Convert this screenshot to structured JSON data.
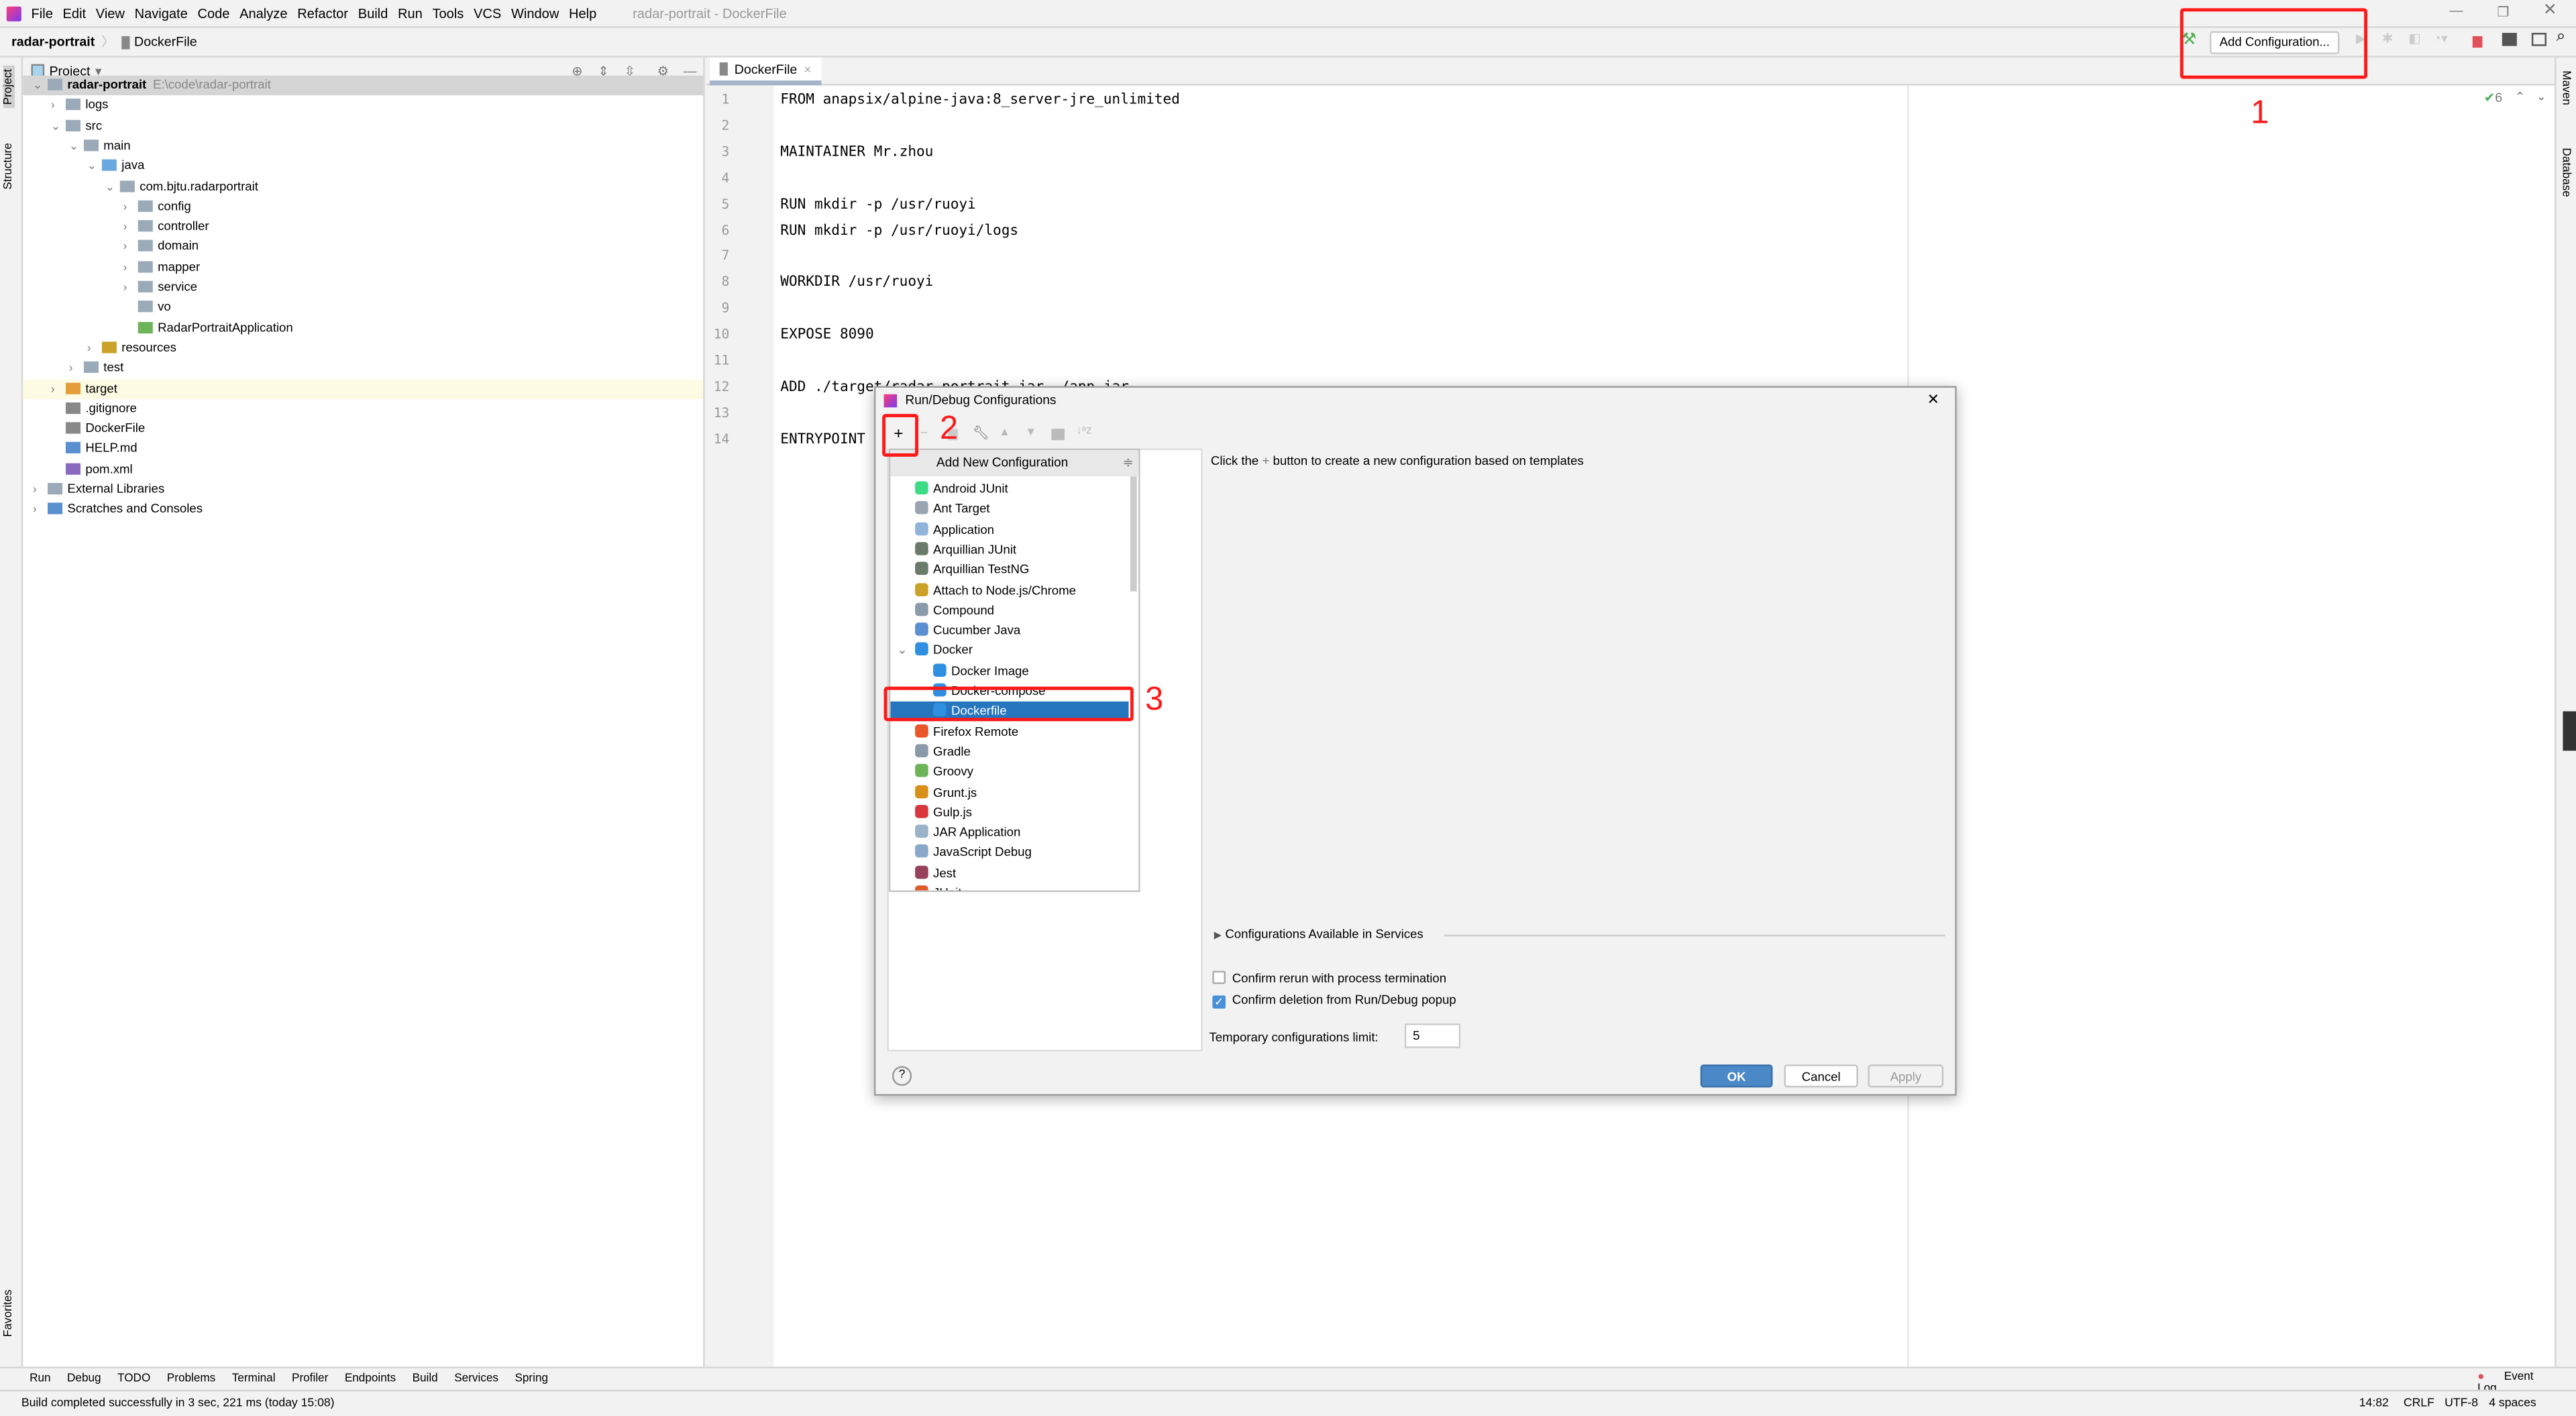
{
  "menu": {
    "items": [
      "File",
      "Edit",
      "View",
      "Navigate",
      "Code",
      "Analyze",
      "Refactor",
      "Build",
      "Run",
      "Tools",
      "VCS",
      "Window",
      "Help"
    ],
    "window_title": "radar-portrait - DockerFile"
  },
  "breadcrumb": {
    "project": "radar-portrait",
    "file": "DockerFile"
  },
  "toolbar": {
    "add_configuration": "Add Configuration..."
  },
  "left_stripe": {
    "project": "Project",
    "structure": "Structure",
    "favorites": "Favorites"
  },
  "right_stripe": {
    "maven": "Maven",
    "database": "Database"
  },
  "project_panel": {
    "title": "Project",
    "tree": [
      {
        "label": "radar-portrait",
        "path": "E:\\code\\radar-portrait",
        "level": 0,
        "expanded": true,
        "bold": true,
        "icon": "module-folder"
      },
      {
        "label": "logs",
        "level": 1,
        "expanded": false,
        "icon": "folder"
      },
      {
        "label": "src",
        "level": 1,
        "expanded": true,
        "icon": "folder"
      },
      {
        "label": "main",
        "level": 2,
        "expanded": true,
        "icon": "folder"
      },
      {
        "label": "java",
        "level": 3,
        "expanded": true,
        "icon": "source-folder"
      },
      {
        "label": "com.bjtu.radarportrait",
        "level": 4,
        "expanded": true,
        "icon": "package"
      },
      {
        "label": "config",
        "level": 5,
        "expanded": false,
        "icon": "package"
      },
      {
        "label": "controller",
        "level": 5,
        "expanded": false,
        "icon": "package"
      },
      {
        "label": "domain",
        "level": 5,
        "expanded": false,
        "icon": "package"
      },
      {
        "label": "mapper",
        "level": 5,
        "expanded": false,
        "icon": "package"
      },
      {
        "label": "service",
        "level": 5,
        "expanded": false,
        "icon": "package"
      },
      {
        "label": "vo",
        "level": 5,
        "icon": "package"
      },
      {
        "label": "RadarPortraitApplication",
        "level": 5,
        "icon": "spring-class"
      },
      {
        "label": "resources",
        "level": 3,
        "expanded": false,
        "icon": "resources-folder"
      },
      {
        "label": "test",
        "level": 2,
        "expanded": false,
        "icon": "folder"
      },
      {
        "label": "target",
        "level": 1,
        "expanded": false,
        "icon": "excluded-folder",
        "highlight": true
      },
      {
        "label": ".gitignore",
        "level": 1,
        "icon": "file"
      },
      {
        "label": "DockerFile",
        "level": 1,
        "icon": "file"
      },
      {
        "label": "HELP.md",
        "level": 1,
        "icon": "markdown"
      },
      {
        "label": "pom.xml",
        "level": 1,
        "icon": "maven"
      },
      {
        "label": "External Libraries",
        "level": 0,
        "expanded": false,
        "icon": "libraries"
      },
      {
        "label": "Scratches and Consoles",
        "level": 0,
        "expanded": false,
        "icon": "scratches"
      }
    ]
  },
  "editor": {
    "tab": "DockerFile",
    "inspection_count": "6",
    "lines": [
      "FROM anapsix/alpine-java:8_server-jre_unlimited",
      "",
      "MAINTAINER Mr.zhou",
      "",
      "RUN mkdir -p /usr/ruoyi",
      "RUN mkdir -p /usr/ruoyi/logs",
      "",
      "WORKDIR /usr/ruoyi",
      "",
      "EXPOSE 8090",
      "",
      "ADD ./target/radar-portrait.jar ./app.jar",
      "",
      "ENTRYPOINT"
    ]
  },
  "dialog": {
    "title": "Run/Debug Configurations",
    "list_header": "Add New Configuration",
    "items": [
      {
        "label": "Android JUnit",
        "color": "#3ddc84"
      },
      {
        "label": "Ant Target",
        "color": "#9aa5b1"
      },
      {
        "label": "Application",
        "color": "#8fb3d9"
      },
      {
        "label": "Arquillian JUnit",
        "color": "#6b7b6b"
      },
      {
        "label": "Arquillian TestNG",
        "color": "#6b7b6b"
      },
      {
        "label": "Attach to Node.js/Chrome",
        "color": "#c9a227"
      },
      {
        "label": "Compound",
        "color": "#8a9aa8"
      },
      {
        "label": "Cucumber Java",
        "color": "#5a8fd0"
      },
      {
        "label": "Docker",
        "color": "#2f8fe0",
        "group": true
      },
      {
        "label": "Docker Image",
        "color": "#2f8fe0",
        "child": true
      },
      {
        "label": "Docker-compose",
        "color": "#2f8fe0",
        "child": true
      },
      {
        "label": "Dockerfile",
        "color": "#2f8fe0",
        "child": true,
        "selected": true
      },
      {
        "label": "Firefox Remote",
        "color": "#e8562a"
      },
      {
        "label": "Gradle",
        "color": "#8a9aa8"
      },
      {
        "label": "Groovy",
        "color": "#6cb35a"
      },
      {
        "label": "Grunt.js",
        "color": "#d9901a"
      },
      {
        "label": "Gulp.js",
        "color": "#d9363e"
      },
      {
        "label": "JAR Application",
        "color": "#9ab3c9"
      },
      {
        "label": "JavaScript Debug",
        "color": "#8aa8c9"
      },
      {
        "label": "Jest",
        "color": "#99425b"
      },
      {
        "label": "JUnit",
        "color": "#e05a2a"
      }
    ],
    "hint_prefix": "Click the",
    "hint_suffix": "button to create a new configuration based on templates",
    "services_label": "Configurations Available in Services",
    "confirm_rerun": {
      "label": "Confirm rerun with process termination",
      "checked": false
    },
    "confirm_deletion": {
      "label": "Confirm deletion from Run/Debug popup",
      "checked": true
    },
    "temp_limit_label": "Temporary configurations limit:",
    "temp_limit_value": "5",
    "ok": "OK",
    "cancel": "Cancel",
    "apply": "Apply",
    "help": "?"
  },
  "annotations": [
    "1",
    "2",
    "3"
  ],
  "bottom_tools": [
    "Run",
    "Debug",
    "TODO",
    "Problems",
    "Terminal",
    "Profiler",
    "Endpoints",
    "Build",
    "Services",
    "Spring"
  ],
  "event_log": "Event Log",
  "status": {
    "message": "Build completed successfully in 3 sec, 221 ms (today 15:08)",
    "position": "14:82",
    "line_sep": "CRLF",
    "encoding": "UTF-8",
    "indent": "4 spaces"
  },
  "colors": {
    "accent": "#2675bf",
    "annotation": "#ff1a1a",
    "ok_button": "#4a88c7"
  }
}
